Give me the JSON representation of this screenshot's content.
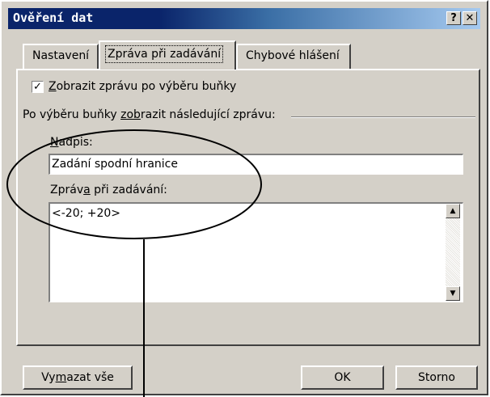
{
  "window": {
    "title": "Ověření dat",
    "help_button": "?",
    "close_button": "✕"
  },
  "tabs": [
    {
      "label": "Nastavení",
      "active": false
    },
    {
      "label": "Zpráva při zadávání",
      "active": true
    },
    {
      "label": "Chybové hlášení",
      "active": false
    }
  ],
  "input_message": {
    "checkbox_checked": true,
    "checkbox_mark": "✓",
    "checkbox_label_accel": "Z",
    "checkbox_label_rest": "obrazit zprávu po výběru buňky",
    "group_label_pre": "Po výběru buňky ",
    "group_label_accel": "zob",
    "group_label_post": "razit následující zprávu:",
    "title_label_accel": "N",
    "title_label_rest": "adpis:",
    "title_value": "Zadání spodní hranice",
    "message_label_pre": "Zpráv",
    "message_label_accel": "a",
    "message_label_post": " při zadávání:",
    "message_value": "<-20; +20>"
  },
  "scrollbar": {
    "up_arrow": "▲",
    "down_arrow": "▼"
  },
  "buttons": {
    "clear_pre": "Vy",
    "clear_accel": "m",
    "clear_post": "azat vše",
    "ok": "OK",
    "cancel": "Storno"
  },
  "colors": {
    "dialog_face": "#d4d0c8",
    "titlebar_start": "#0a246a",
    "titlebar_end": "#a6caf0"
  }
}
